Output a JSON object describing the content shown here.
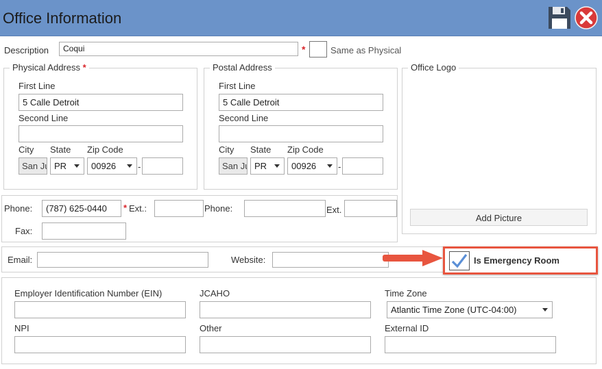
{
  "window": {
    "title": "Office Information"
  },
  "toolbar": {
    "save_icon": "save-icon",
    "close_icon": "close-icon"
  },
  "description": {
    "label": "Description",
    "value": "Coqui",
    "required_mark": "*",
    "same_as_physical_label": "Same as Physical"
  },
  "physical_address": {
    "legend": "Physical Address",
    "required_mark": "*",
    "first_line_label": "First Line",
    "first_line_value": "5 Calle Detroit",
    "second_line_label": "Second Line",
    "second_line_value": "",
    "city_label": "City",
    "city_value": "San Ju",
    "state_label": "State",
    "state_value": "PR",
    "zip_label": "Zip Code",
    "zip_value": "00926",
    "zip_ext_value": "",
    "zip_sep": "-"
  },
  "postal_address": {
    "legend": "Postal Address",
    "first_line_label": "First Line",
    "first_line_value": "5 Calle Detroit",
    "second_line_label": "Second Line",
    "second_line_value": "",
    "city_label": "City",
    "city_value": "San Ju",
    "state_label": "State",
    "state_value": "PR",
    "zip_label": "Zip Code",
    "zip_value": "00926",
    "zip_ext_value": "",
    "zip_sep": "-"
  },
  "office_logo": {
    "legend": "Office Logo",
    "add_picture_label": "Add Picture"
  },
  "contact": {
    "phone_label": "Phone:",
    "phone_value": "(787) 625-0440",
    "ext_required_mark": "*",
    "ext_label": "Ext.:",
    "ext_value": "",
    "phone2_label": "Phone:",
    "phone2_value": "",
    "ext2_label": "Ext.",
    "ext2_value": "",
    "fax_label": "Fax:",
    "fax_value": ""
  },
  "web": {
    "email_label": "Email:",
    "email_value": "",
    "website_label": "Website:",
    "website_value": "",
    "emergency_label": "Is Emergency Room",
    "emergency_checked": true
  },
  "ids": {
    "ein_label": "Employer Identification Number (EIN)",
    "ein_value": "",
    "jcaho_label": "JCAHO",
    "jcaho_value": "",
    "timezone_label": "Time Zone",
    "timezone_value": "Atlantic Time Zone (UTC-04:00)",
    "npi_label": "NPI",
    "npi_value": "",
    "other_label": "Other",
    "other_value": "",
    "external_id_label": "External ID",
    "external_id_value": ""
  },
  "colors": {
    "titlebar": "#6b93c9",
    "arrow": "#e8553f",
    "highlight_border": "#e8553f",
    "check": "#5b8fd6"
  }
}
